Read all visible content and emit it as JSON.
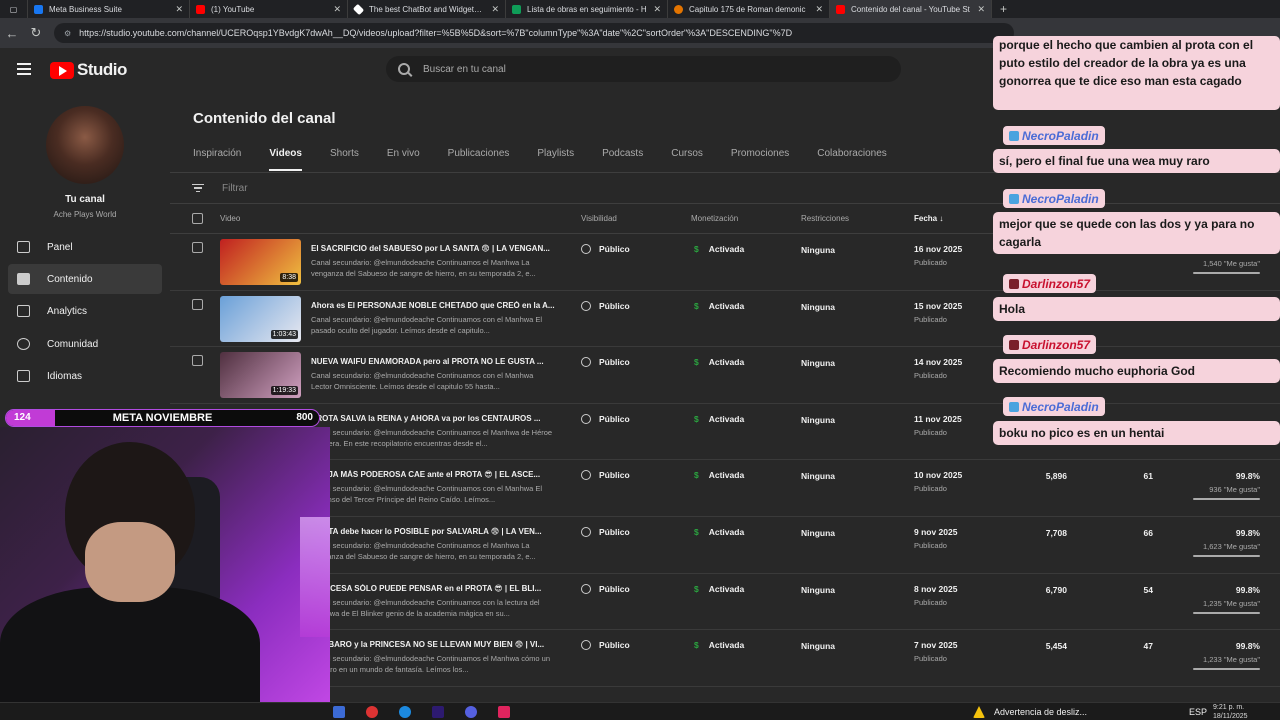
{
  "browser": {
    "tabs": [
      {
        "label": "Meta Business Suite",
        "color": "#1877f2"
      },
      {
        "label": "(1) YouTube",
        "color": "#ff0000"
      },
      {
        "label": "The best ChatBot and Widgets fo",
        "color": "#ffffff"
      },
      {
        "label": "Lista de obras en seguimiento - H",
        "color": "#0f9d58"
      },
      {
        "label": "Capitulo 175 de Roman demonic",
        "color": "#e37400"
      },
      {
        "label": "Contenido del canal - YouTube St",
        "color": "#ff0000"
      }
    ],
    "url": "https://studio.youtube.com/channel/UCEROqsp1YBvdgK7dwAh__DQ/videos/upload?filter=%5B%5D&sort=%7B\"columnType\"%3A\"date\"%2C\"sortOrder\"%3A\"DESCENDING\"%7D"
  },
  "header": {
    "logo": "Studio",
    "search_placeholder": "Buscar en tu canal"
  },
  "sidebar": {
    "channel_title": "Tu canal",
    "channel_name": "Ache Plays World",
    "items": [
      {
        "label": "Panel"
      },
      {
        "label": "Contenido"
      },
      {
        "label": "Analytics"
      },
      {
        "label": "Comunidad"
      },
      {
        "label": "Idiomas"
      }
    ]
  },
  "main": {
    "title": "Contenido del canal",
    "tabs": [
      "Inspiración",
      "Videos",
      "Shorts",
      "En vivo",
      "Publicaciones",
      "Playlists",
      "Podcasts",
      "Cursos",
      "Promociones",
      "Colaboraciones"
    ],
    "filter_placeholder": "Filtrar",
    "columns": {
      "video": "Video",
      "visibility": "Visibilidad",
      "monetization": "Monetización",
      "restrictions": "Restricciones",
      "date": "Fecha"
    }
  },
  "videos": [
    {
      "title": "El SACRIFICIO del SABUESO por LA SANTA 😨 | LA VENGAN...",
      "desc": "Canal secundario: @elmundodeache Continuamos el Manhwa La venganza del Sabueso de sangre de hierro, en su temporada 2, e...",
      "duration": "8:38",
      "visibility": "Público",
      "monetization": "Activada",
      "restrictions": "Ninguna",
      "date": "16 nov 2025",
      "status": "Publicado",
      "views": "",
      "comments": "",
      "pct": "",
      "likes": "1,540 \"Me gusta\""
    },
    {
      "title": "Ahora es El PERSONAJE NOBLE CHETADO que CREÓ en la A...",
      "desc": "Canal secundario: @elmundodeache Continuamos con el Manhwa El pasado oculto del jugador. Leímos desde el capitulo...",
      "duration": "1:03:43",
      "visibility": "Público",
      "monetization": "Activada",
      "restrictions": "Ninguna",
      "date": "15 nov 2025",
      "status": "Publicado",
      "views": "",
      "comments": "",
      "pct": "",
      "likes": ""
    },
    {
      "title": "NUEVA WAIFU ENAMORADA pero al PROTA NO LE GUSTA ...",
      "desc": "Canal secundario: @elmundodeache Continuamos con el Manhwa Lector Omnisciente. Leímos desde el capitulo 55 hasta...",
      "duration": "1:19:33",
      "visibility": "Público",
      "monetization": "Activada",
      "restrictions": "Ninguna",
      "date": "14 nov 2025",
      "status": "Publicado",
      "views": "",
      "comments": "",
      "pct": "",
      "likes": ""
    },
    {
      "title": "PROTA SALVA la REINA y AHORA va por los CENTAUROS ...",
      "desc": "Canal secundario: @elmundodeache Continuamos el Manhwa de Héroe Frontera. En este recopilatorio encuentras desde el...",
      "duration": "",
      "visibility": "Público",
      "monetization": "Activada",
      "restrictions": "Ninguna",
      "date": "11 nov 2025",
      "status": "Publicado",
      "views": "",
      "comments": "",
      "pct": "",
      "likes": ""
    },
    {
      "title": "BRUJA MÁS PODEROSA CAE ante el PROTA 😎 | EL ASCE...",
      "desc": "Canal secundario: @elmundodeache Continuamos con el Manhwa El Ascenso del Tercer Príncipe del Reino Caído. Leímos...",
      "duration": "",
      "visibility": "Público",
      "monetization": "Activada",
      "restrictions": "Ninguna",
      "date": "10 nov 2025",
      "status": "Publicado",
      "views": "5,896",
      "comments": "61",
      "pct": "99.8%",
      "likes": "936 \"Me gusta\""
    },
    {
      "title": "PROTA debe hacer lo POSIBLE por SALVARLA 😨 | LA VEN...",
      "desc": "Canal secundario: @elmundodeache Continuamos el Manhwa La venganza del Sabueso de sangre de hierro, en su temporada 2, e...",
      "duration": "",
      "visibility": "Público",
      "monetization": "Activada",
      "restrictions": "Ninguna",
      "date": "9 nov 2025",
      "status": "Publicado",
      "views": "7,708",
      "comments": "66",
      "pct": "99.8%",
      "likes": "1,623 \"Me gusta\""
    },
    {
      "title": "PRINCESA SÓLO PUEDE PENSAR en el PROTA 😎 | EL BLI...",
      "desc": "Canal secundario: @elmundodeache Continuamos con la lectura del Manhwa de El Blinker genio de la academia mágica en su...",
      "duration": "",
      "visibility": "Público",
      "monetization": "Activada",
      "restrictions": "Ninguna",
      "date": "8 nov 2025",
      "status": "Publicado",
      "views": "6,790",
      "comments": "54",
      "pct": "99.8%",
      "likes": "1,235 \"Me gusta\""
    },
    {
      "title": "BÁRBARO y la PRINCESA NO SE LLEVAN MUY BIEN 😨 | VI...",
      "desc": "Canal secundario: @elmundodeache Continuamos el Manhwa cómo un bárbaro en un mundo de fantasía. Leímos los...",
      "duration": "",
      "visibility": "Público",
      "monetization": "Activada",
      "restrictions": "Ninguna",
      "date": "7 nov 2025",
      "status": "Publicado",
      "views": "5,454",
      "comments": "47",
      "pct": "99.8%",
      "likes": "1,233 \"Me gusta\""
    }
  ],
  "chat": [
    {
      "user": "",
      "text": "porque el hecho que cambien al prota con el puto estilo del creador de la obra ya es una gonorrea que te dice eso man esta cagado"
    },
    {
      "user": "NecroPaladin",
      "text": "sí, pero el final fue una wea muy raro"
    },
    {
      "user": "NecroPaladin",
      "text": "mejor que se quede con las dos y ya para no cagarla"
    },
    {
      "user": "Darlinzon57",
      "text": "Hola"
    },
    {
      "user": "Darlinzon57",
      "text": "Recomiendo mucho euphoria God"
    },
    {
      "user": "NecroPaladin",
      "text": "boku no pico es en un hentai"
    }
  ],
  "meta_bar": {
    "current": "124",
    "label": "META NOVIEMBRE",
    "goal": "800",
    "progress": 0.155
  },
  "taskbar": {
    "notification": "Advertencia de desliz...",
    "language": "ESP",
    "time": "9:21 p. m.",
    "date": "18/11/2025"
  }
}
